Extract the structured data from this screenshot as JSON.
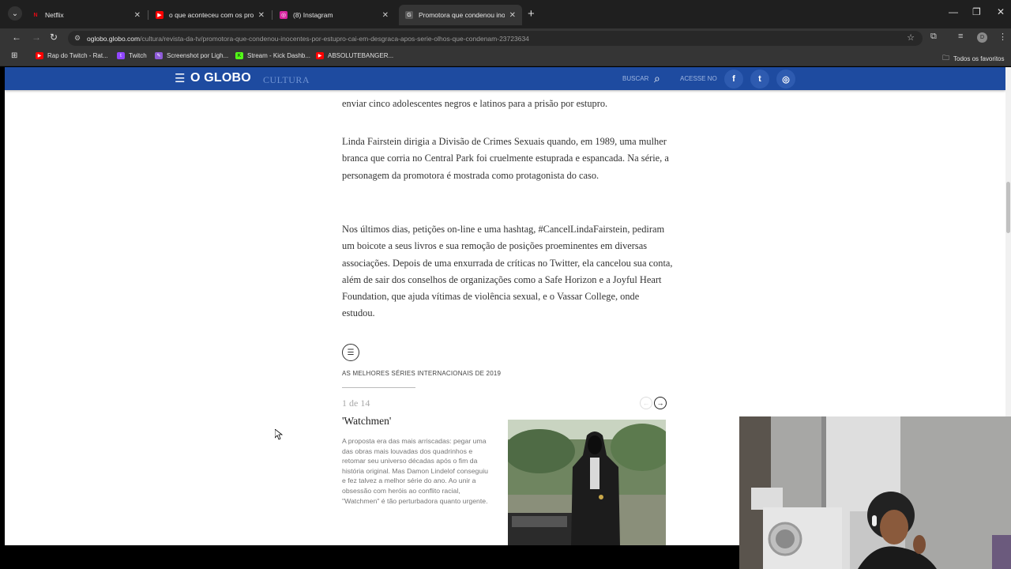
{
  "tabs": [
    {
      "title": "Netflix",
      "fav_color": "#e50914",
      "fav_glyph": "N",
      "active": false
    },
    {
      "title": "o que aconteceu com os promo",
      "fav_color": "#ff0000",
      "fav_glyph": "▶",
      "active": false
    },
    {
      "title": "(8) Instagram",
      "fav_color": "#d6249f",
      "fav_glyph": "◎",
      "active": false
    },
    {
      "title": "Promotora que condenou inoce",
      "fav_color": "#4a4a4a",
      "fav_glyph": "G",
      "active": true
    }
  ],
  "address": {
    "host": "oglobo.globo.com",
    "path": "/cultura/revista-da-tv/promotora-que-condenou-inocentes-por-estupro-cai-em-desgraca-apos-serie-olhos-que-condenam-23723634"
  },
  "profile_initial": "D",
  "bookmarks": [
    {
      "label": "Rap do Twitch - Rat...",
      "color": "#ff0000",
      "glyph": "▶"
    },
    {
      "label": "Twitch",
      "color": "#9146ff",
      "glyph": "t"
    },
    {
      "label": "Screenshot por Ligh...",
      "color": "#8e5bd8",
      "glyph": "✎"
    },
    {
      "label": "Stream - Kick Dashb...",
      "color": "#53fc18",
      "glyph": "K"
    },
    {
      "label": "ABSOLUTEBANGER...",
      "color": "#ff0000",
      "glyph": "▶"
    }
  ],
  "bookmarks_folder": "Todos os favoritos",
  "site": {
    "logo": "O GLOBO",
    "section": "CULTURA",
    "search_label": "BUSCAR",
    "login_label": "ACESSE NO",
    "social": [
      "f",
      "t",
      "◎"
    ]
  },
  "article": {
    "p0": "enviar cinco adolescentes negros e latinos para a prisão por estupro.",
    "p1": "Linda Fairstein dirigia a Divisão de Crimes Sexuais quando, em 1989, uma mulher branca que corria no Central Park foi cruelmente estuprada e espancada. Na série, a personagem da promotora é mostrada como protagonista do caso.",
    "p2": "Nos últimos dias, petições on-line e uma hashtag, #CancelLindaFairstein, pediram um boicote a seus livros e sua remoção de posições proeminentes em diversas associações. Depois de uma enxurrada de críticas no Twitter, ela cancelou sua conta, além de sair dos conselhos de organizações como a Safe Horizon e a Joyful Heart Foundation, que ajuda vítimas de violência sexual, e o Vassar College, onde estudou."
  },
  "gallery": {
    "title": "AS MELHORES SÉRIES INTERNACIONAIS DE 2019",
    "counter": "1 de 14",
    "slide_title": "'Watchmen'",
    "slide_text": "A proposta era das mais arriscadas: pegar uma das obras mais louvadas dos quadrinhos e retomar seu universo décadas após o fim da história original. Mas Damon Lindelof conseguiu e fez talvez a melhor série do ano. Ao unir a obsessão com heróis ao conflito racial, \"Watchmen\" é tão perturbadora quanto urgente."
  }
}
